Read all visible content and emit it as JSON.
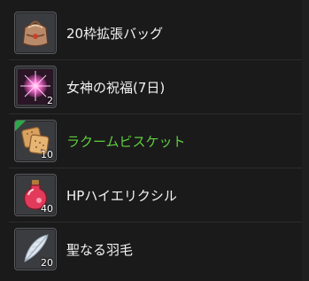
{
  "colors": {
    "background": "#1a1a1b",
    "text_default": "#f2f2f2",
    "text_highlight": "#5fcf3a",
    "corner_badge": "#2ea84a"
  },
  "items": [
    {
      "name": "20枠拡張バッグ",
      "count": "",
      "icon": "bag-icon"
    },
    {
      "name": "女神の祝福(7日)",
      "count": "2",
      "icon": "blessing-orb-icon"
    },
    {
      "name": "ラクームビスケット",
      "count": "10",
      "icon": "biscuit-icon"
    },
    {
      "name": "HPハイエリクシル",
      "count": "40",
      "icon": "potion-icon"
    },
    {
      "name": "聖なる羽毛",
      "count": "20",
      "icon": "feather-icon"
    }
  ]
}
